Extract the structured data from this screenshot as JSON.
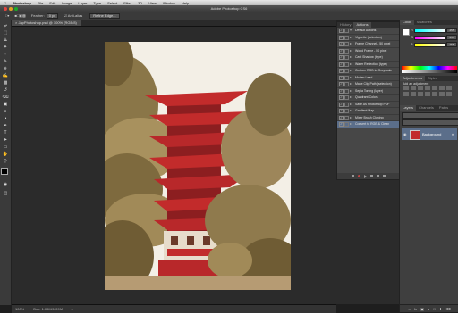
{
  "menubar": {
    "app_name": "Photoshop",
    "items": [
      "File",
      "Edit",
      "Image",
      "Layer",
      "Type",
      "Select",
      "Filter",
      "3D",
      "View",
      "Window",
      "Help"
    ]
  },
  "window": {
    "title": "Adobe Photoshop CS6"
  },
  "options_bar": {
    "feather_label": "Feather:",
    "feather_value": "0 px",
    "antialias_label": "Anti-alias",
    "refine_edge_label": "Refine Edge..."
  },
  "document_tab": {
    "label": "JapPhotoshop.psd @ 100% (RGB/8)"
  },
  "status_bar": {
    "zoom": "100%",
    "doc_info": "Doc: 1.09M/1.09M"
  },
  "actions_panel": {
    "tabs": [
      "History",
      "Actions"
    ],
    "rows": [
      {
        "label": "Default Actions",
        "selected": false
      },
      {
        "label": "Vignette (selection)",
        "selected": false
      },
      {
        "label": "Frame Channel - 50 pixel",
        "selected": false
      },
      {
        "label": "Wood Frame - 50 pixel",
        "selected": false
      },
      {
        "label": "Cast Shadow (type)",
        "selected": false
      },
      {
        "label": "Water Reflection (type)",
        "selected": false
      },
      {
        "label": "Custom RGB to Grayscale",
        "selected": false
      },
      {
        "label": "Molten Lead",
        "selected": false
      },
      {
        "label": "Make Clip Path (selection)",
        "selected": false
      },
      {
        "label": "Sepia Toning (layer)",
        "selected": false
      },
      {
        "label": "Quadrant Colors",
        "selected": false
      },
      {
        "label": "Save As Photoshop PDF",
        "selected": false
      },
      {
        "label": "Gradient Map",
        "selected": false
      },
      {
        "label": "Mixer Brush Cloning",
        "selected": false
      },
      {
        "label": "Convert to RGB & Clean",
        "selected": true
      }
    ]
  },
  "right_panel": {
    "color_tabs": [
      "Color",
      "Swatches"
    ],
    "channels": [
      {
        "name": "R",
        "value": "255"
      },
      {
        "name": "G",
        "value": "255"
      },
      {
        "name": "B",
        "value": "255"
      }
    ],
    "adjust_tabs": [
      "Adjustments",
      "Styles"
    ],
    "adjust_hint": "Add an adjustment",
    "layer_tabs": [
      "Layers",
      "Channels",
      "Paths"
    ],
    "layer_name": "Background"
  },
  "colors": {
    "selection": "#5b6e8a",
    "panel": "#474747",
    "sky": "#f3efe6",
    "pagoda": "#b8282a"
  }
}
